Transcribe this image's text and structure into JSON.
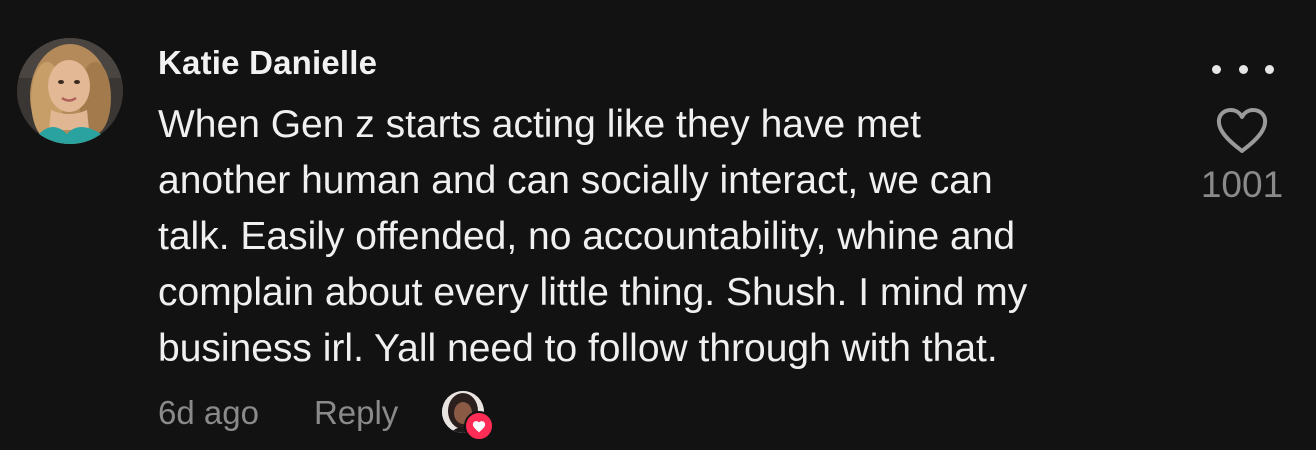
{
  "comment": {
    "author": "Katie Danielle",
    "avatar_icon": "user-avatar-photo",
    "text_lines": [
      "When Gen z starts acting like they have met",
      "another human and can socially interact, we can",
      "talk. Easily offended, no accountability, whine and",
      "complain about every little thing. Shush. I mind my",
      "business irl. Yall need to follow through with that."
    ],
    "timestamp": "6d ago",
    "reply_label": "Reply",
    "like_count": "1001",
    "liked_by_creator_icon": "creator-liked-heart-badge"
  },
  "icons": {
    "more": "more-dots-icon",
    "like": "heart-outline-icon"
  },
  "colors": {
    "background": "#121212",
    "primary_text": "#f0f0f0",
    "secondary_text": "#8a8a8a",
    "heart_badge": "#ff2d55"
  }
}
